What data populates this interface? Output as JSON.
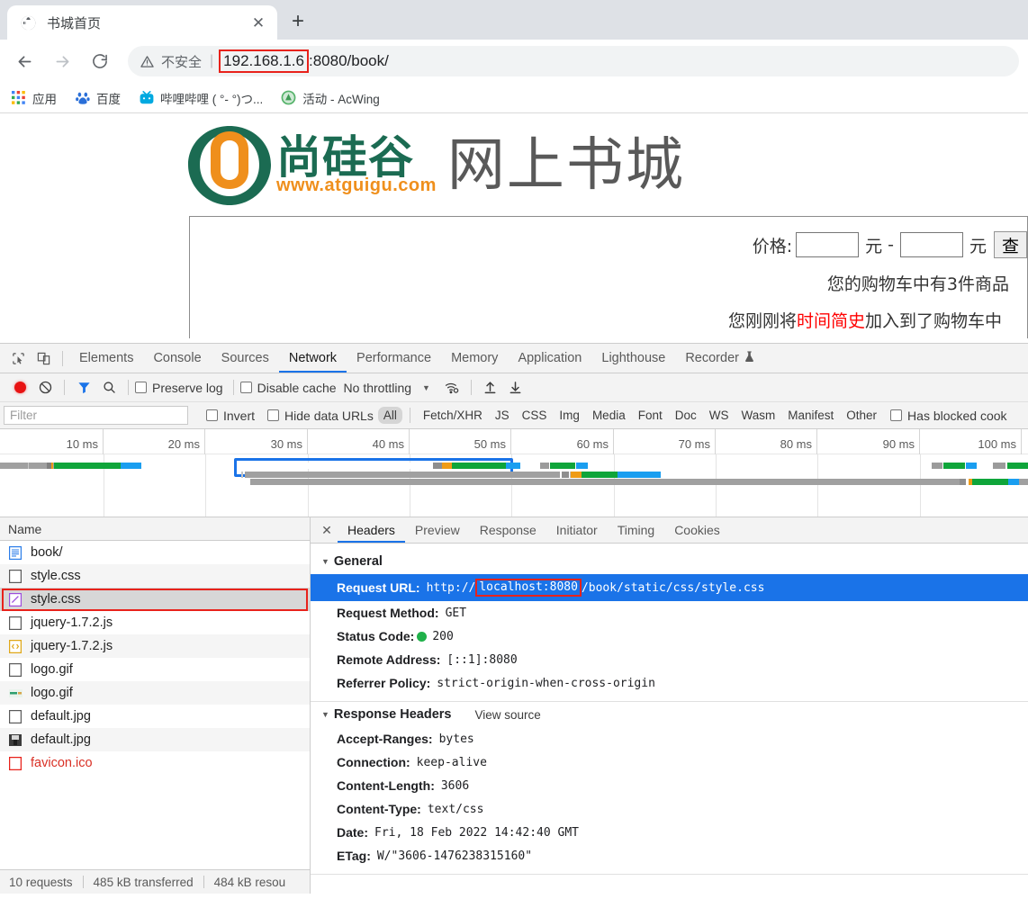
{
  "browser": {
    "tab": {
      "title": "书城首页",
      "favicon": "globe-icon",
      "close_label": "✕"
    },
    "newtab_label": "+",
    "nav": {
      "back": "←",
      "forward": "→",
      "reload": "⟳"
    },
    "omnibox": {
      "warning_icon": "warning-triangle-icon",
      "security_text": "不安全",
      "separator": "|",
      "url_host": "192.168.1.6",
      "url_rest": ":8080/book/"
    },
    "bookmarks": [
      {
        "label": "应用",
        "icon": "apps-grid-icon"
      },
      {
        "label": "百度",
        "icon": "baidu-paw-icon"
      },
      {
        "label": "哔哩哔哩 ( °- °)つ...",
        "icon": "bilibili-icon"
      },
      {
        "label": "活动 - AcWing",
        "icon": "acwing-icon"
      }
    ]
  },
  "page": {
    "logo": {
      "cn": "尚硅谷",
      "url": "www.atguigu.com"
    },
    "title": "网上书城",
    "search": {
      "price_label": "价格:",
      "min_value": "",
      "max_value": "",
      "min_placeholder": "",
      "max_placeholder": "",
      "unit": "元",
      "dash": "-",
      "submit_label": "查"
    },
    "cart_summary": "您的购物车中有3件商品",
    "cart_notice_prefix": "您刚刚将",
    "cart_notice_book": "时间简史",
    "cart_notice_suffix": "加入到了购物车中"
  },
  "devtools": {
    "toolbar_icons": [
      {
        "name": "inspect-element-icon"
      },
      {
        "name": "device-toolbar-icon"
      }
    ],
    "tabs": [
      {
        "label": "Elements",
        "active": false
      },
      {
        "label": "Console",
        "active": false
      },
      {
        "label": "Sources",
        "active": false
      },
      {
        "label": "Network",
        "active": true
      },
      {
        "label": "Performance",
        "active": false
      },
      {
        "label": "Memory",
        "active": false
      },
      {
        "label": "Application",
        "active": false
      },
      {
        "label": "Lighthouse",
        "active": false
      },
      {
        "label": "Recorder",
        "active": false,
        "badge": "flask-icon"
      }
    ],
    "controls": {
      "record_title": "record-button",
      "clear_title": "clear-button",
      "filter_title": "filter-button",
      "search_title": "search-button",
      "preserve_log": "Preserve log",
      "preserve_log_checked": false,
      "disable_cache": "Disable cache",
      "disable_cache_checked": false,
      "throttling": "No throttling",
      "caret": "▼",
      "network_conditions_title": "network-conditions-icon",
      "import_title": "import-har-icon",
      "export_title": "export-har-icon"
    },
    "filterbar": {
      "filter_placeholder": "Filter",
      "filter_value": "",
      "invert": "Invert",
      "invert_checked": false,
      "hide_data_urls": "Hide data URLs",
      "hide_data_urls_checked": false,
      "types": [
        "All",
        "Fetch/XHR",
        "JS",
        "CSS",
        "Img",
        "Media",
        "Font",
        "Doc",
        "WS",
        "Wasm",
        "Manifest",
        "Other"
      ],
      "selected_type": "All",
      "has_blocked_cookies": "Has blocked cook",
      "has_blocked_cookies_checked": false
    },
    "overview": {
      "ticks": [
        "10 ms",
        "20 ms",
        "30 ms",
        "40 ms",
        "50 ms",
        "60 ms",
        "70 ms",
        "80 ms",
        "90 ms",
        "100 ms"
      ]
    },
    "requests": {
      "column_header": "Name",
      "rows": [
        {
          "name": "book/",
          "icon": "document-icon",
          "selected": false,
          "error": false
        },
        {
          "name": "style.css",
          "icon": "empty-doc-icon",
          "selected": false,
          "error": false
        },
        {
          "name": "style.css",
          "icon": "stylesheet-icon",
          "selected": true,
          "error": false,
          "highlighted": true
        },
        {
          "name": "jquery-1.7.2.js",
          "icon": "empty-doc-icon",
          "selected": false,
          "error": false
        },
        {
          "name": "jquery-1.7.2.js",
          "icon": "script-icon",
          "selected": false,
          "error": false
        },
        {
          "name": "logo.gif",
          "icon": "empty-doc-icon",
          "selected": false,
          "error": false
        },
        {
          "name": "logo.gif",
          "icon": "image-thumb-icon",
          "selected": false,
          "error": false
        },
        {
          "name": "default.jpg",
          "icon": "empty-doc-icon",
          "selected": false,
          "error": false
        },
        {
          "name": "default.jpg",
          "icon": "image-thumb-icon",
          "selected": false,
          "error": false
        },
        {
          "name": "favicon.ico",
          "icon": "error-doc-icon",
          "selected": false,
          "error": true
        }
      ]
    },
    "status_bar": {
      "requests": "10 requests",
      "transferred": "485 kB transferred",
      "resources": "484 kB resou"
    },
    "details": {
      "close_label": "✕",
      "tabs": [
        {
          "label": "Headers",
          "active": true
        },
        {
          "label": "Preview",
          "active": false
        },
        {
          "label": "Response",
          "active": false
        },
        {
          "label": "Initiator",
          "active": false
        },
        {
          "label": "Timing",
          "active": false
        },
        {
          "label": "Cookies",
          "active": false
        }
      ],
      "general": {
        "title": "General",
        "request_url_key": "Request URL:",
        "request_url_scheme": "http://",
        "request_url_host": "localhost:8080",
        "request_url_path": "/book/static/css/style.css",
        "rows": [
          {
            "key": "Request Method:",
            "value": "GET"
          },
          {
            "key": "Status Code:",
            "value": "200",
            "status_dot": "#20b14a"
          },
          {
            "key": "Remote Address:",
            "value": "[::1]:8080"
          },
          {
            "key": "Referrer Policy:",
            "value": "strict-origin-when-cross-origin"
          }
        ]
      },
      "response_headers": {
        "title": "Response Headers",
        "view_source": "View source",
        "rows": [
          {
            "key": "Accept-Ranges:",
            "value": "bytes"
          },
          {
            "key": "Connection:",
            "value": "keep-alive"
          },
          {
            "key": "Content-Length:",
            "value": "3606"
          },
          {
            "key": "Content-Type:",
            "value": "text/css"
          },
          {
            "key": "Date:",
            "value": "Fri, 18 Feb 2022 14:42:40 GMT"
          },
          {
            "key": "ETag:",
            "value": "W/\"3606-1476238315160\""
          }
        ]
      }
    }
  },
  "colors": {
    "accent": "#1a73e8",
    "highlight_red": "#e8221b",
    "status_green": "#20b14a",
    "error_red": "#d93025",
    "logo_green": "#1b6b52",
    "logo_orange": "#ef8f1c"
  }
}
